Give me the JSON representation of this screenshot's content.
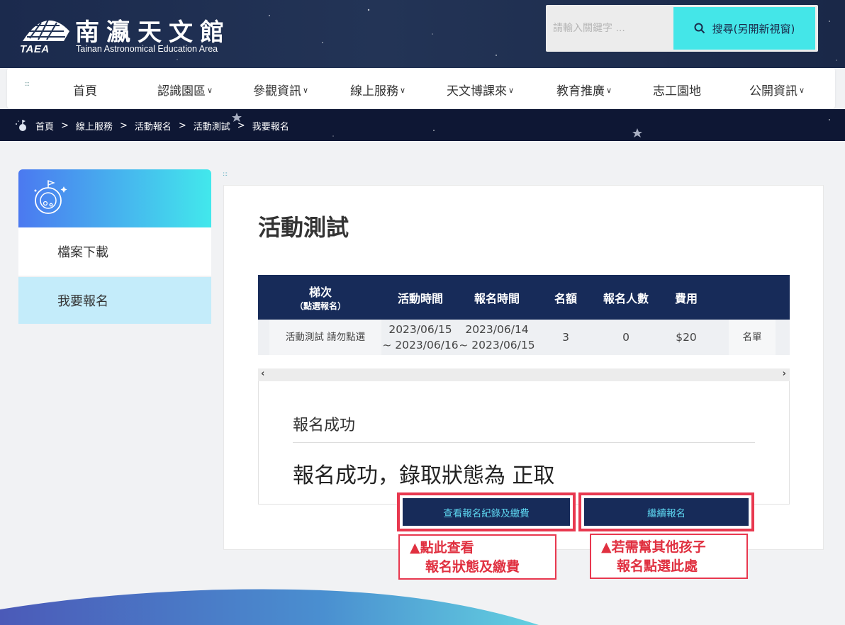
{
  "header": {
    "site_title": "南瀛天文館",
    "site_subtitle": "Tainan Astronomical Education Area",
    "logo_abbr": "TAEA",
    "search_placeholder": "請輸入關鍵字 ...",
    "search_button": "搜尋(另開新視窗)"
  },
  "nav": {
    "items": [
      {
        "label": "首頁",
        "dropdown": false
      },
      {
        "label": "認識園區",
        "dropdown": true
      },
      {
        "label": "參觀資訊",
        "dropdown": true
      },
      {
        "label": "線上服務",
        "dropdown": true
      },
      {
        "label": "天文博課來",
        "dropdown": true
      },
      {
        "label": "教育推廣",
        "dropdown": true
      },
      {
        "label": "志工園地",
        "dropdown": false
      },
      {
        "label": "公開資訊",
        "dropdown": true
      }
    ]
  },
  "breadcrumb": [
    "首頁",
    "線上服務",
    "活動報名",
    "活動測試",
    "我要報名"
  ],
  "sidebar": {
    "items": [
      {
        "label": "檔案下載"
      },
      {
        "label": "我要報名"
      }
    ]
  },
  "main": {
    "title": "活動測試",
    "table": {
      "headers": {
        "batch": "梯次",
        "batch_note": "（點選報名）",
        "event_time": "活動時間",
        "signup_time": "報名時間",
        "quota": "名額",
        "count": "報名人數",
        "fee": "費用"
      },
      "row": {
        "name": "活動測試 請勿點選",
        "event_start": "2023/06/15",
        "event_end": "~ 2023/06/16",
        "signup_start": "2023/06/14",
        "signup_end": "~ 2023/06/15",
        "quota": "3",
        "count": "0",
        "fee": "$20",
        "roster": "名單"
      }
    },
    "scroll_left": "‹",
    "scroll_right": "›",
    "result_heading": "報名成功",
    "result_message": "報名成功，錄取狀態為 正取",
    "buttons": {
      "view_records": "查看報名紀錄及繳費",
      "continue": "繼續報名"
    },
    "notes": {
      "view_line1": "▲點此查看",
      "view_line2": "報名狀態及繳費",
      "continue_line1": "▲若需幫其他孩子",
      "continue_line2": "報名點選此處"
    }
  },
  "colors": {
    "header_bg": "#1b2a4d",
    "accent_cyan": "#44e6e8",
    "table_head": "#172b59",
    "highlight_red": "#e8384f",
    "sidebar_active": "#c4ecfa"
  }
}
